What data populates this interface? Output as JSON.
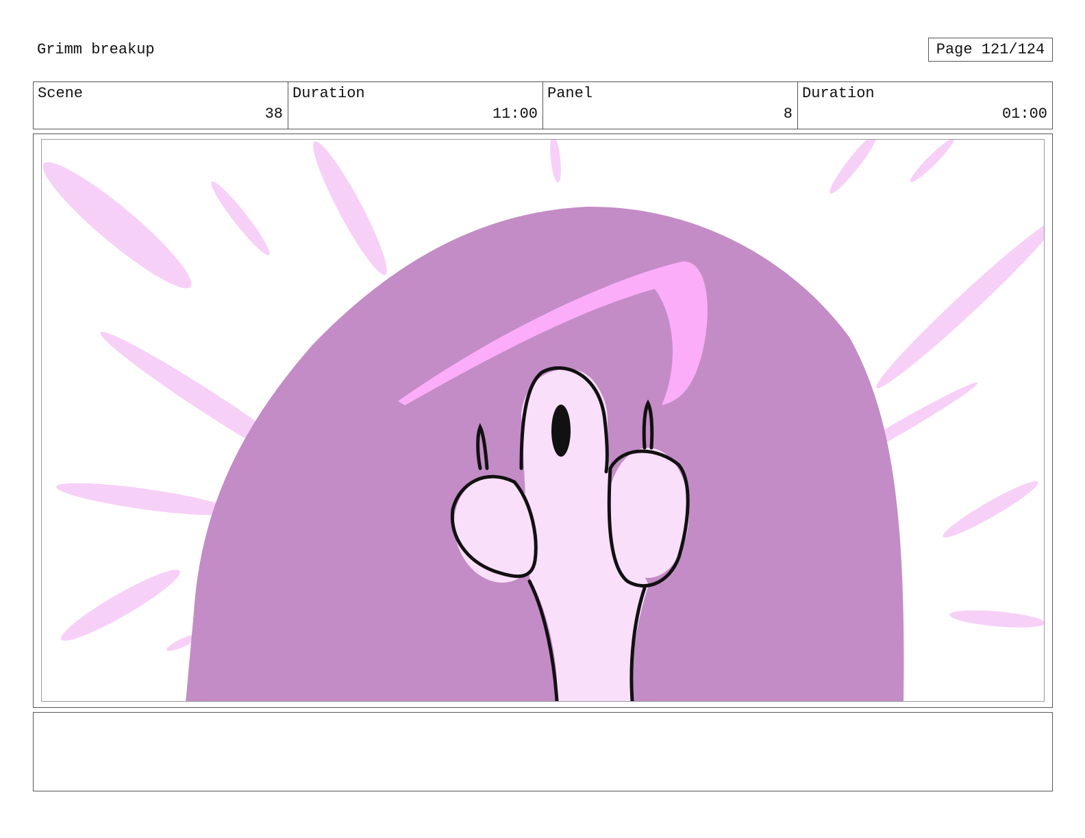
{
  "header": {
    "title": "Grimm breakup",
    "page_label": "Page 121/124"
  },
  "info": [
    {
      "label": "Scene",
      "value": "38"
    },
    {
      "label": "Duration",
      "value": "11:00"
    },
    {
      "label": "Panel",
      "value": "8"
    },
    {
      "label": "Duration",
      "value": "01:00"
    }
  ],
  "panel": {
    "colors": {
      "burst": "#c38cc6",
      "rays": "#f7d0f8",
      "highlight": "#fbadf9",
      "skin": "#fadffb",
      "outline": "#111111"
    }
  },
  "notes": {
    "text": ""
  }
}
